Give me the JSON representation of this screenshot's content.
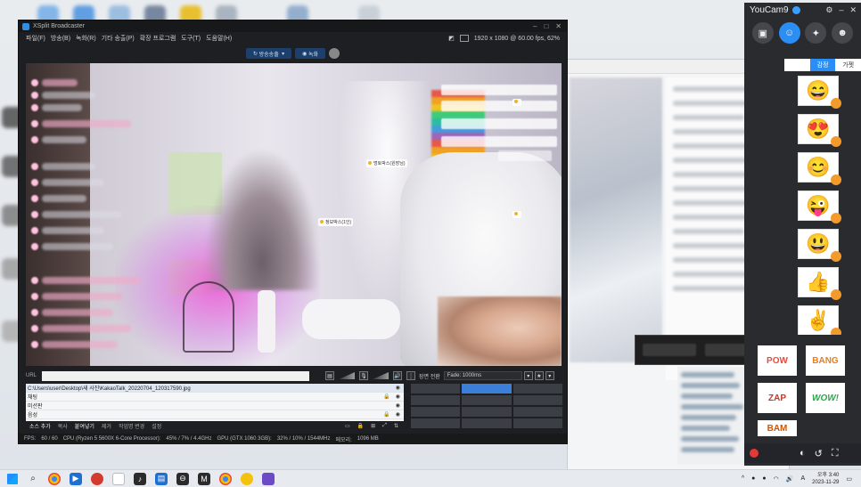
{
  "xsplit": {
    "app_title": "XSplit Broadcaster",
    "menu": [
      "파일(F)",
      "방송(B)",
      "녹화(R)",
      "기타 송출(P)",
      "확장 프로그램",
      "도구(T)",
      "도움말(H)"
    ],
    "resolution": "1920 x 1080 @ 60.00 fps, 62%",
    "toolbar": {
      "broadcast_label": "방송송출",
      "record_label": "녹화"
    },
    "canvas_tags": [
      "멍토박스(원장님)",
      "정보박스(1인)"
    ],
    "scene_transition_label": "장면 전환",
    "transition_value": "Fade: 1000ms",
    "sources": [
      "C:\\Users\\user\\Desktop\\새 사진\\KakaoTalk_20220704_120317590.jpg",
      "채팅",
      "미션판",
      "음성"
    ],
    "source_actions": [
      "소스 추가",
      "복사",
      "붙여넣기",
      "제거",
      "작업명 변경",
      "설정"
    ],
    "status": {
      "fps": "60 / 60",
      "cpu_label": "CPU (Ryzen 5 5600X 6-Core Processor):",
      "cpu_value": "45% / 7% / 4.4GHz",
      "gpu_label": "GPU (GTX 1060 3GB):",
      "gpu_value": "32% / 10% / 1544MHz",
      "memory_label": "메모리:",
      "memory_value": "1096 MB"
    }
  },
  "youcam": {
    "title": "YouCam",
    "version": "9",
    "tabs": [
      "감정",
      "가젯"
    ],
    "emojis": [
      "😄",
      "😍",
      "😊",
      "😜",
      "😃",
      "👍",
      "✌️"
    ],
    "stickers": [
      "POW",
      "BANG",
      "ZAP",
      "WOW!",
      "BAM"
    ]
  },
  "taskbar": {
    "time": "오후 3:40",
    "date": "2023-11-29",
    "ime": "A"
  },
  "colors": {
    "accent": "#2b8ef5",
    "xsplit_bg": "#1d1f22",
    "record_red": "#e53935"
  }
}
